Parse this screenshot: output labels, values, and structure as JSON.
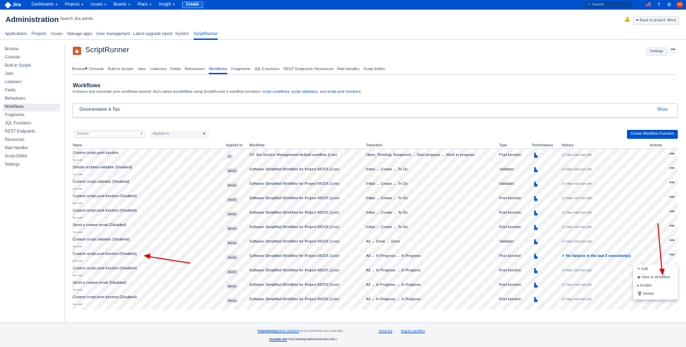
{
  "topnav": {
    "brand": "Jira",
    "items": [
      {
        "label": "Dashboards"
      },
      {
        "label": "Projects"
      },
      {
        "label": "Issues"
      },
      {
        "label": "Boards"
      },
      {
        "label": "Plans"
      },
      {
        "label": "Insight"
      }
    ],
    "create_label": "Create",
    "search_placeholder": "Search",
    "avatar_initials": "AD"
  },
  "admin": {
    "title": "Administration",
    "search_label": "Search Jira admin",
    "back_label": "Back to project: Mock",
    "tabs": [
      {
        "label": "Applications"
      },
      {
        "label": "Projects"
      },
      {
        "label": "Issues"
      },
      {
        "label": "Manage apps"
      },
      {
        "label": "User management"
      },
      {
        "label": "Latest upgrade report"
      },
      {
        "label": "System"
      },
      {
        "label": "ScriptRunner"
      }
    ]
  },
  "sidebar": {
    "items": [
      {
        "label": "Browse"
      },
      {
        "label": "Console"
      },
      {
        "label": "Built-in Scripts"
      },
      {
        "label": "Jobs"
      },
      {
        "label": "Listeners"
      },
      {
        "label": "Fields"
      },
      {
        "label": "Behaviours"
      },
      {
        "label": "Workflows"
      },
      {
        "label": "Fragments"
      },
      {
        "label": "JQL Functions"
      },
      {
        "label": "REST Endpoints"
      },
      {
        "label": "Resources"
      },
      {
        "label": "Mail Handler"
      },
      {
        "label": "Script Editor"
      },
      {
        "label": "Settings"
      }
    ]
  },
  "scriptrunner": {
    "title": "ScriptRunner",
    "settings_label": "Settings",
    "more_label": "•••",
    "tabs": [
      {
        "label": "Browse"
      },
      {
        "label": "Console"
      },
      {
        "label": "Built-in Scripts"
      },
      {
        "label": "Jobs"
      },
      {
        "label": "Listeners"
      },
      {
        "label": "Fields"
      },
      {
        "label": "Behaviours"
      },
      {
        "label": "Workflows"
      },
      {
        "label": "Fragments"
      },
      {
        "label": "JQL Functions"
      },
      {
        "label": "REST Endpoints"
      },
      {
        "label": "Resources"
      },
      {
        "label": "Mail Handler"
      },
      {
        "label": "Script Editor"
      }
    ]
  },
  "workflows": {
    "title": "Workflows",
    "desc_prefix": "Enhance and automate your workflows beyond Jira's native possibilities using ScriptRunner's workflow functions: ",
    "link1": "script conditions",
    "sep1": ", ",
    "link2": "script validators",
    "sep2": ", and ",
    "link3": "script post functions",
    "desc_suffix": ".",
    "doc_title": "Documentation & Tips",
    "doc_show": "Show",
    "search_placeholder": "Search",
    "applied_placeholder": "Applied to",
    "create_label": "Create Workflow Function"
  },
  "table": {
    "headers": {
      "name": "Name",
      "applied": "Applied to",
      "workflow": "Workflow",
      "transition": "Transition",
      "type": "Type",
      "performance": "Performance",
      "history": "History",
      "actions": "Actions"
    },
    "rows": [
      {
        "name": "Custom script post-function",
        "note": "No note",
        "badge": "ST",
        "workflow": "ST: Jira Service Management default workflow (Live)",
        "transition": "Open, Pending, Reopened → Start progress → Work in progress",
        "type": "Post function",
        "history": "Has not run yet",
        "ok": false
      },
      {
        "name": "Simple scripted validator (Disabled)",
        "note": "No note",
        "badge": "MOCK",
        "workflow": "Software Simplified Workflow for Project MOCK (Live)",
        "transition": "Initial → Create → To Do",
        "type": "Validator",
        "history": "Has not run yet",
        "ok": false
      },
      {
        "name": "Custom script validator (Disabled)",
        "note": "No note",
        "badge": "MOCK",
        "workflow": "Software Simplified Workflow for Project MOCK (Live)",
        "transition": "Initial → Create → To Do",
        "type": "Validator",
        "history": "Has not run yet",
        "ok": false
      },
      {
        "name": "Custom script post-function (Disabled)",
        "note": "No note",
        "badge": "MOCK",
        "workflow": "Software Simplified Workflow for Project MOCK (Live)",
        "transition": "Initial → Create → To Do",
        "type": "Post function",
        "history": "Has not run yet",
        "ok": false
      },
      {
        "name": "Custom script post-function (Disabled)",
        "note": "No note",
        "badge": "MOCK",
        "workflow": "Software Simplified Workflow for Project MOCK (Live)",
        "transition": "Initial → Create → To Do",
        "type": "Post function",
        "history": "Has not run yet",
        "ok": false
      },
      {
        "name": "Send a custom email (Disabled)",
        "note": "No note",
        "badge": "MOCK",
        "workflow": "Software Simplified Workflow for Project MOCK (Live)",
        "transition": "Initial → Create → To Do",
        "type": "Post function",
        "history": "Has not run yet",
        "ok": false
      },
      {
        "name": "Custom script validator (Disabled)",
        "note": "No note",
        "badge": "MOCK",
        "workflow": "Software Simplified Workflow for Project MOCK (Live)",
        "transition": "All → Done → Done",
        "type": "Validator",
        "history": "Has not run yet",
        "ok": false
      },
      {
        "name": "Custom script post-function (Disabled)",
        "note": "No note",
        "badge": "MOCK",
        "workflow": "Software Simplified Workflow for Project MOCK (Live)",
        "transition": "All → In Progress → In Progress",
        "type": "Post function",
        "history": "No failures in the last 3 execution(s)",
        "ok": true
      },
      {
        "name": "Custom script post-function (Disabled)",
        "note": "No note",
        "badge": "MOCK",
        "workflow": "Software Simplified Workflow for Project MOCK (Live)",
        "transition": "All → In Progress → In Progress",
        "type": "Post function",
        "history": "Has not run yet",
        "ok": false
      },
      {
        "name": "Send a custom email (Disabled)",
        "note": "No note",
        "badge": "MOCK",
        "workflow": "Software Simplified Workflow for Project MOCK (Live)",
        "transition": "All → In Progress → In Progress",
        "type": "Post function",
        "history": "Has not run yet",
        "ok": false
      },
      {
        "name": "Custom script post-function (Disabled)",
        "note": "No note",
        "badge": "MOCK",
        "workflow": "Software Simplified Workflow for Project MOCK (Live)",
        "transition": "All → In Progress → In Progress",
        "type": "Post function",
        "history": "Has not run yet",
        "ok": false
      }
    ]
  },
  "dropdown": {
    "edit": "Edit",
    "view": "View in Workflow",
    "enable": "Enable",
    "delete": "Delete"
  },
  "footer": {
    "line1_prefix": "Atlassian Jira ",
    "line1_link": "Project Management Software",
    "line1_version": " (v8.22.2#822002-sha1:165c8f5)",
    "about": "About Jira",
    "report": "Report a problem",
    "line2_prefix": "This Jira site is for demonstration purposes only. ",
    "line2_link": "Evaluate Jira",
    "line2_suffix": " - bug tracking software for your team."
  },
  "colors": {
    "brand": "#0052cc",
    "annotation": "#e00000"
  }
}
